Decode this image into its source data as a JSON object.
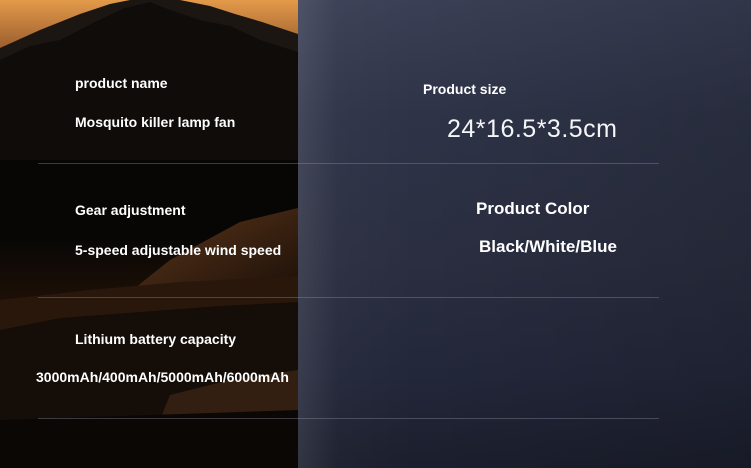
{
  "specs": {
    "product_name": {
      "label": "product name",
      "value": "Mosquito killer lamp fan"
    },
    "product_size": {
      "label": "Product size",
      "value": "24*16.5*3.5cm"
    },
    "gear_adjustment": {
      "label": "Gear adjustment",
      "value": "5-speed adjustable wind speed"
    },
    "product_color": {
      "label": "Product Color",
      "value": "Black/White/Blue"
    },
    "battery": {
      "label": "Lithium battery capacity",
      "value": "3000mAh/400mAh/5000mAh/6000mAh"
    }
  }
}
